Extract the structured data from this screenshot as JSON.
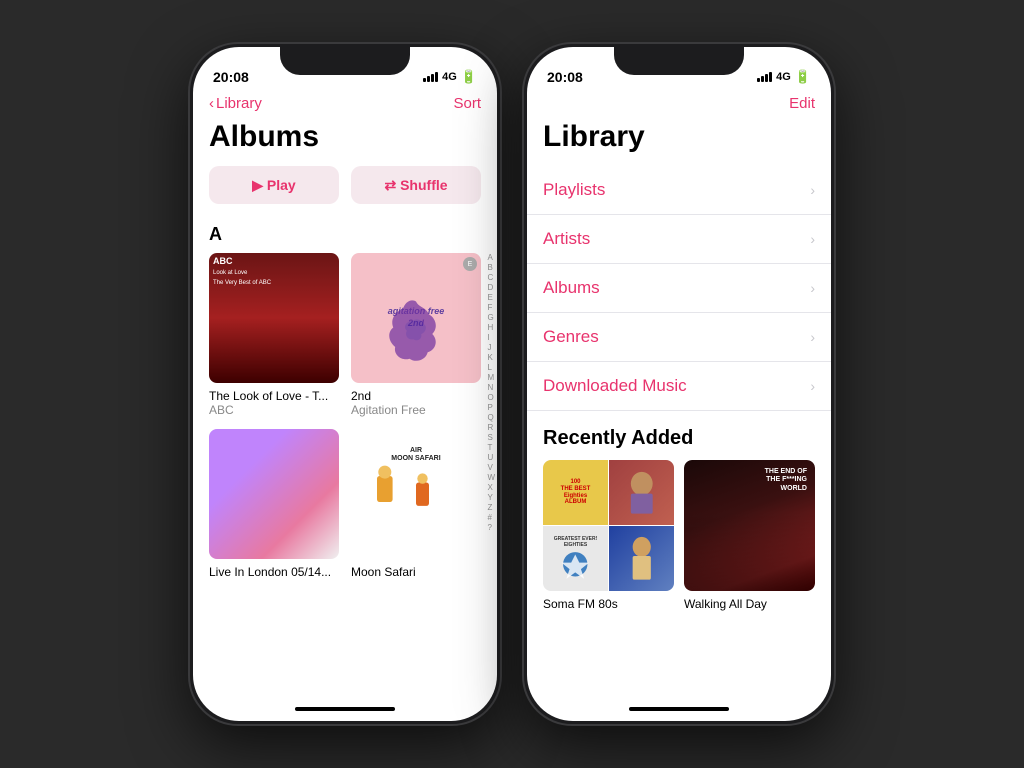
{
  "background_color": "#2a2a2a",
  "phone1": {
    "status_time": "20:08",
    "signal": "4G",
    "nav_back": "Library",
    "nav_action": "Sort",
    "page_title": "Albums",
    "play_label": "▶  Play",
    "shuffle_label": "⇄  Shuffle",
    "section_letter": "A",
    "albums": [
      {
        "title": "The Look of Love - T...",
        "artist": "ABC",
        "art_type": "abc"
      },
      {
        "title": "2nd",
        "artist": "Agitation Free",
        "art_type": "agitation"
      },
      {
        "title": "Live In London 05/14...",
        "artist": "",
        "art_type": "live"
      },
      {
        "title": "Moon Safari",
        "artist": "",
        "art_type": "moon"
      }
    ],
    "alpha": [
      "A",
      "B",
      "C",
      "D",
      "E",
      "F",
      "G",
      "H",
      "I",
      "J",
      "K",
      "L",
      "M",
      "N",
      "O",
      "P",
      "Q",
      "R",
      "S",
      "T",
      "U",
      "V",
      "W",
      "X",
      "Y",
      "Z",
      "#",
      "?"
    ]
  },
  "phone2": {
    "status_time": "20:08",
    "signal": "4G",
    "nav_action": "Edit",
    "page_title": "Library",
    "library_items": [
      {
        "label": "Playlists"
      },
      {
        "label": "Artists"
      },
      {
        "label": "Albums"
      },
      {
        "label": "Genres"
      },
      {
        "label": "Downloaded Music"
      }
    ],
    "recently_added_title": "Recently Added",
    "recent_albums": [
      {
        "title": "Soma FM 80s",
        "art_type": "eighties"
      },
      {
        "title": "Walking All Day",
        "art_type": "walking"
      }
    ]
  }
}
